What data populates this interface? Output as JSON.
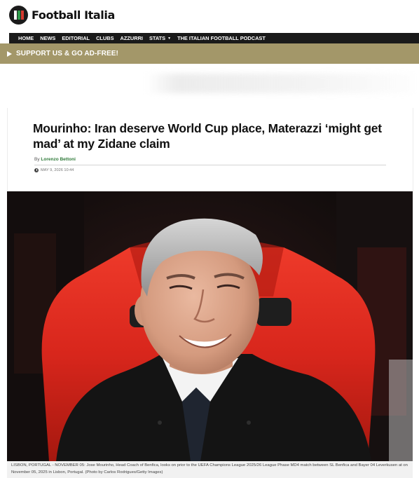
{
  "site": {
    "name": "Football Italia",
    "logo_icon": "football-italia-logo-icon"
  },
  "nav": {
    "items": [
      "HOME",
      "NEWS",
      "EDITORIAL",
      "CLUBS",
      "AZZURRI",
      "STATS",
      "THE ITALIAN FOOTBALL PODCAST"
    ],
    "stats_caret_icon": "caret-down-icon"
  },
  "support_banner": {
    "label": "SUPPORT US & GO AD-FREE!",
    "icon": "play-arrow-icon",
    "background": "#a39769"
  },
  "article": {
    "headline": "Mourinho: Iran deserve World Cup place, Materazzi ‘might get mad’ at my Zidane claim",
    "by_label": "By",
    "author": "Lorenzo Bettoni",
    "date": "MAY 9, 2026 10:44",
    "date_icon": "clock-icon",
    "image_caption": "LISBON, PORTUGAL - NOVEMBER 05: Jose Mourinho, Head Coach of Benfica, looks on prior to the UEFA Champions League 2025/26 League Phase MD4 match between SL Benfica and Bayer 04 Leverkusen at on November 05, 2025 in Lisbon, Portugal. (Photo by Carlos Rodrigues/Getty Images)"
  },
  "colors": {
    "nav_bg": "#1a1a1a",
    "author_green": "#2f7a3a",
    "seat_red": "#d8261c"
  }
}
